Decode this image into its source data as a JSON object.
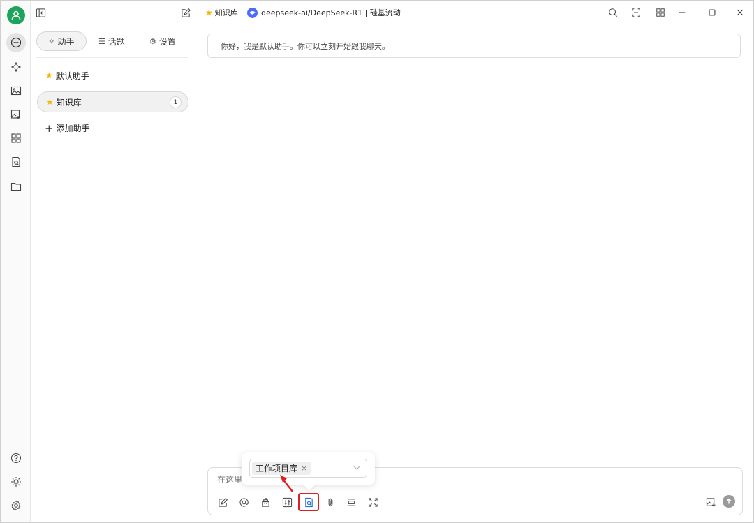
{
  "titlebar": {
    "current_assistant": "知识库",
    "model_label": "deepseek-ai/DeepSeek-R1 | 硅基流动"
  },
  "sidebar": {
    "tabs": [
      {
        "label": "助手",
        "icon": "sparkle-icon"
      },
      {
        "label": "话题",
        "icon": "list-icon"
      },
      {
        "label": "设置",
        "icon": "gear-icon"
      }
    ],
    "assistants": [
      {
        "label": "默认助手",
        "active": false
      },
      {
        "label": "知识库",
        "active": true,
        "count": "1"
      }
    ],
    "add_label": "添加助手"
  },
  "chat": {
    "greeting": "你好，我是默认助手。你可以立刻开始跟我聊天。"
  },
  "input": {
    "placeholder": "在这里"
  },
  "knowledge_popup": {
    "selected": "工作项目库",
    "remove": "×"
  },
  "colors": {
    "accent": "#1aa55b",
    "highlight": "#e02020",
    "star": "#f5b400"
  }
}
